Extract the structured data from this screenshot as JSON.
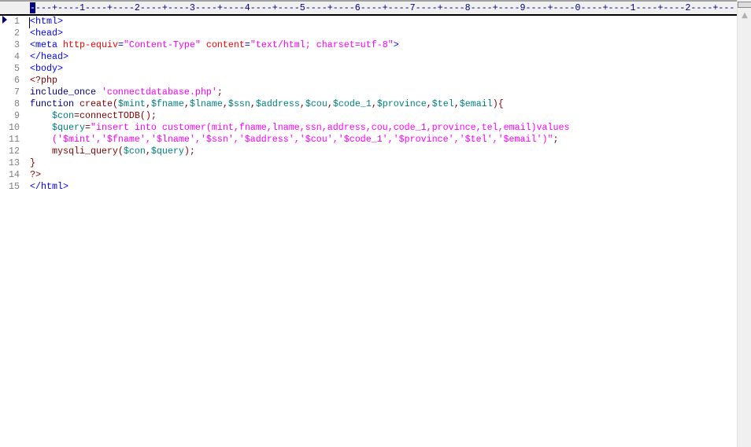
{
  "ruler": {
    "cursor_char": "-",
    "text": "---+----1----+----2----+----3----+----4----+----5----+----6----+----7----+----8----+----9----+----0----+----1----+----2----+---"
  },
  "code_lines": [
    {
      "num": "1",
      "tokens": [
        [
          "tag",
          "<html>"
        ]
      ]
    },
    {
      "num": "2",
      "tokens": [
        [
          "tag",
          "<head>"
        ]
      ]
    },
    {
      "num": "3",
      "tokens": [
        [
          "tag",
          "<meta "
        ],
        [
          "attr",
          "http-equiv"
        ],
        [
          "tag",
          "="
        ],
        [
          "str",
          "\"Content-Type\""
        ],
        [
          "tag",
          " "
        ],
        [
          "attr",
          "content"
        ],
        [
          "tag",
          "="
        ],
        [
          "str",
          "\"text/html; charset=utf-8\""
        ],
        [
          "tag",
          ">"
        ]
      ]
    },
    {
      "num": "4",
      "tokens": [
        [
          "tag",
          "</head>"
        ]
      ]
    },
    {
      "num": "5",
      "tokens": [
        [
          "tag",
          "<body>"
        ]
      ]
    },
    {
      "num": "6",
      "tokens": [
        [
          "php",
          "<?php"
        ]
      ]
    },
    {
      "num": "7",
      "tokens": [
        [
          "kw",
          "include_once "
        ],
        [
          "str",
          "'connectdatabase.php'"
        ],
        [
          "punc",
          ";"
        ]
      ]
    },
    {
      "num": "8",
      "tokens": [
        [
          "kw",
          "function "
        ],
        [
          "fn",
          "create"
        ],
        [
          "punc",
          "("
        ],
        [
          "var",
          "$mint"
        ],
        [
          "punc",
          ","
        ],
        [
          "var",
          "$fname"
        ],
        [
          "punc",
          ","
        ],
        [
          "var",
          "$lname"
        ],
        [
          "punc",
          ","
        ],
        [
          "var",
          "$ssn"
        ],
        [
          "punc",
          ","
        ],
        [
          "var",
          "$address"
        ],
        [
          "punc",
          ","
        ],
        [
          "var",
          "$cou"
        ],
        [
          "punc",
          ","
        ],
        [
          "var",
          "$code_1"
        ],
        [
          "punc",
          ","
        ],
        [
          "var",
          "$province"
        ],
        [
          "punc",
          ","
        ],
        [
          "var",
          "$tel"
        ],
        [
          "punc",
          ","
        ],
        [
          "var",
          "$email"
        ],
        [
          "punc",
          "){"
        ]
      ]
    },
    {
      "num": "9",
      "tokens": [
        [
          "fn",
          "    "
        ],
        [
          "var",
          "$con"
        ],
        [
          "fn",
          "=connectTODB"
        ],
        [
          "punc",
          "();"
        ]
      ]
    },
    {
      "num": "10",
      "tokens": [
        [
          "fn",
          "    "
        ],
        [
          "var",
          "$query"
        ],
        [
          "punc",
          "="
        ],
        [
          "str",
          "\"insert into customer(mint,fname,lname,ssn,address,cou,code_1,province,tel,email)values"
        ]
      ]
    },
    {
      "num": "11",
      "tokens": [
        [
          "str",
          "    ('$mint','$fname','$lname','$ssn','$address','$cou','$code_1','$province','$tel','$email')\""
        ],
        [
          "punc",
          ";"
        ]
      ]
    },
    {
      "num": "12",
      "tokens": [
        [
          "fn",
          "    mysqli_query"
        ],
        [
          "punc",
          "("
        ],
        [
          "var",
          "$con"
        ],
        [
          "punc",
          ","
        ],
        [
          "var",
          "$query"
        ],
        [
          "punc",
          ");"
        ]
      ]
    },
    {
      "num": "13",
      "tokens": [
        [
          "punc",
          "}"
        ]
      ]
    },
    {
      "num": "14",
      "tokens": [
        [
          "php",
          "?>"
        ]
      ]
    },
    {
      "num": "15",
      "tokens": [
        [
          "tag",
          "</html>"
        ]
      ]
    }
  ]
}
